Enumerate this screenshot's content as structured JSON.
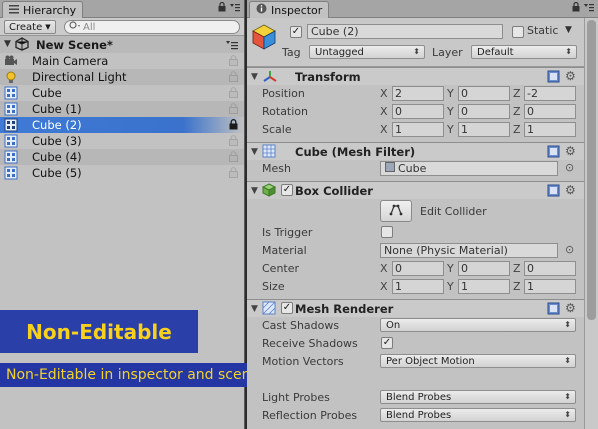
{
  "hierarchy": {
    "tab_label": "Hierarchy",
    "create_label": "Create",
    "search_placeholder": "All",
    "scene_name": "New Scene*",
    "items": [
      {
        "label": "Main Camera",
        "icon": "camera-icon"
      },
      {
        "label": "Directional Light",
        "icon": "light-icon"
      },
      {
        "label": "Cube",
        "icon": "gameobject-icon"
      },
      {
        "label": "Cube (1)",
        "icon": "gameobject-icon"
      },
      {
        "label": "Cube (2)",
        "icon": "gameobject-icon"
      },
      {
        "label": "Cube (3)",
        "icon": "gameobject-icon"
      },
      {
        "label": "Cube (4)",
        "icon": "gameobject-icon"
      },
      {
        "label": "Cube (5)",
        "icon": "gameobject-icon"
      }
    ]
  },
  "overlay": {
    "banner_text": "Non-Editable",
    "caption_text": "Non-Editable in inspector and scene view"
  },
  "inspector": {
    "tab_label": "Inspector",
    "object_name": "Cube (2)",
    "static_label": "Static",
    "tag_label": "Tag",
    "tag_value": "Untagged",
    "layer_label": "Layer",
    "layer_value": "Default",
    "transform": {
      "title": "Transform",
      "position_label": "Position",
      "rotation_label": "Rotation",
      "scale_label": "Scale",
      "position": [
        "2",
        "0",
        "-2"
      ],
      "rotation": [
        "0",
        "0",
        "0"
      ],
      "scale": [
        "1",
        "1",
        "1"
      ]
    },
    "mesh_filter": {
      "title": "Cube (Mesh Filter)",
      "mesh_label": "Mesh",
      "mesh_value": "Cube"
    },
    "box_collider": {
      "title": "Box Collider",
      "edit_label": "Edit Collider",
      "is_trigger_label": "Is Trigger",
      "material_label": "Material",
      "material_value": "None (Physic Material)",
      "center_label": "Center",
      "size_label": "Size",
      "center": [
        "0",
        "0",
        "0"
      ],
      "size": [
        "1",
        "1",
        "1"
      ]
    },
    "mesh_renderer": {
      "title": "Mesh Renderer",
      "cast_shadows_label": "Cast Shadows",
      "cast_shadows_value": "On",
      "receive_shadows_label": "Receive Shadows",
      "motion_vectors_label": "Motion Vectors",
      "motion_vectors_value": "Per Object Motion",
      "light_probes_label": "Light Probes",
      "light_probes_value": "Blend Probes",
      "reflection_probes_label": "Reflection Probes",
      "reflection_probes_value": "Blend Probes"
    },
    "axis_labels": [
      "X",
      "Y",
      "Z"
    ]
  },
  "colors": {
    "selection": "#3e7ad6",
    "banner_bg": "#2b3fa8",
    "banner_text": "#f7d11c",
    "panel_bg": "#c2c2c2"
  }
}
